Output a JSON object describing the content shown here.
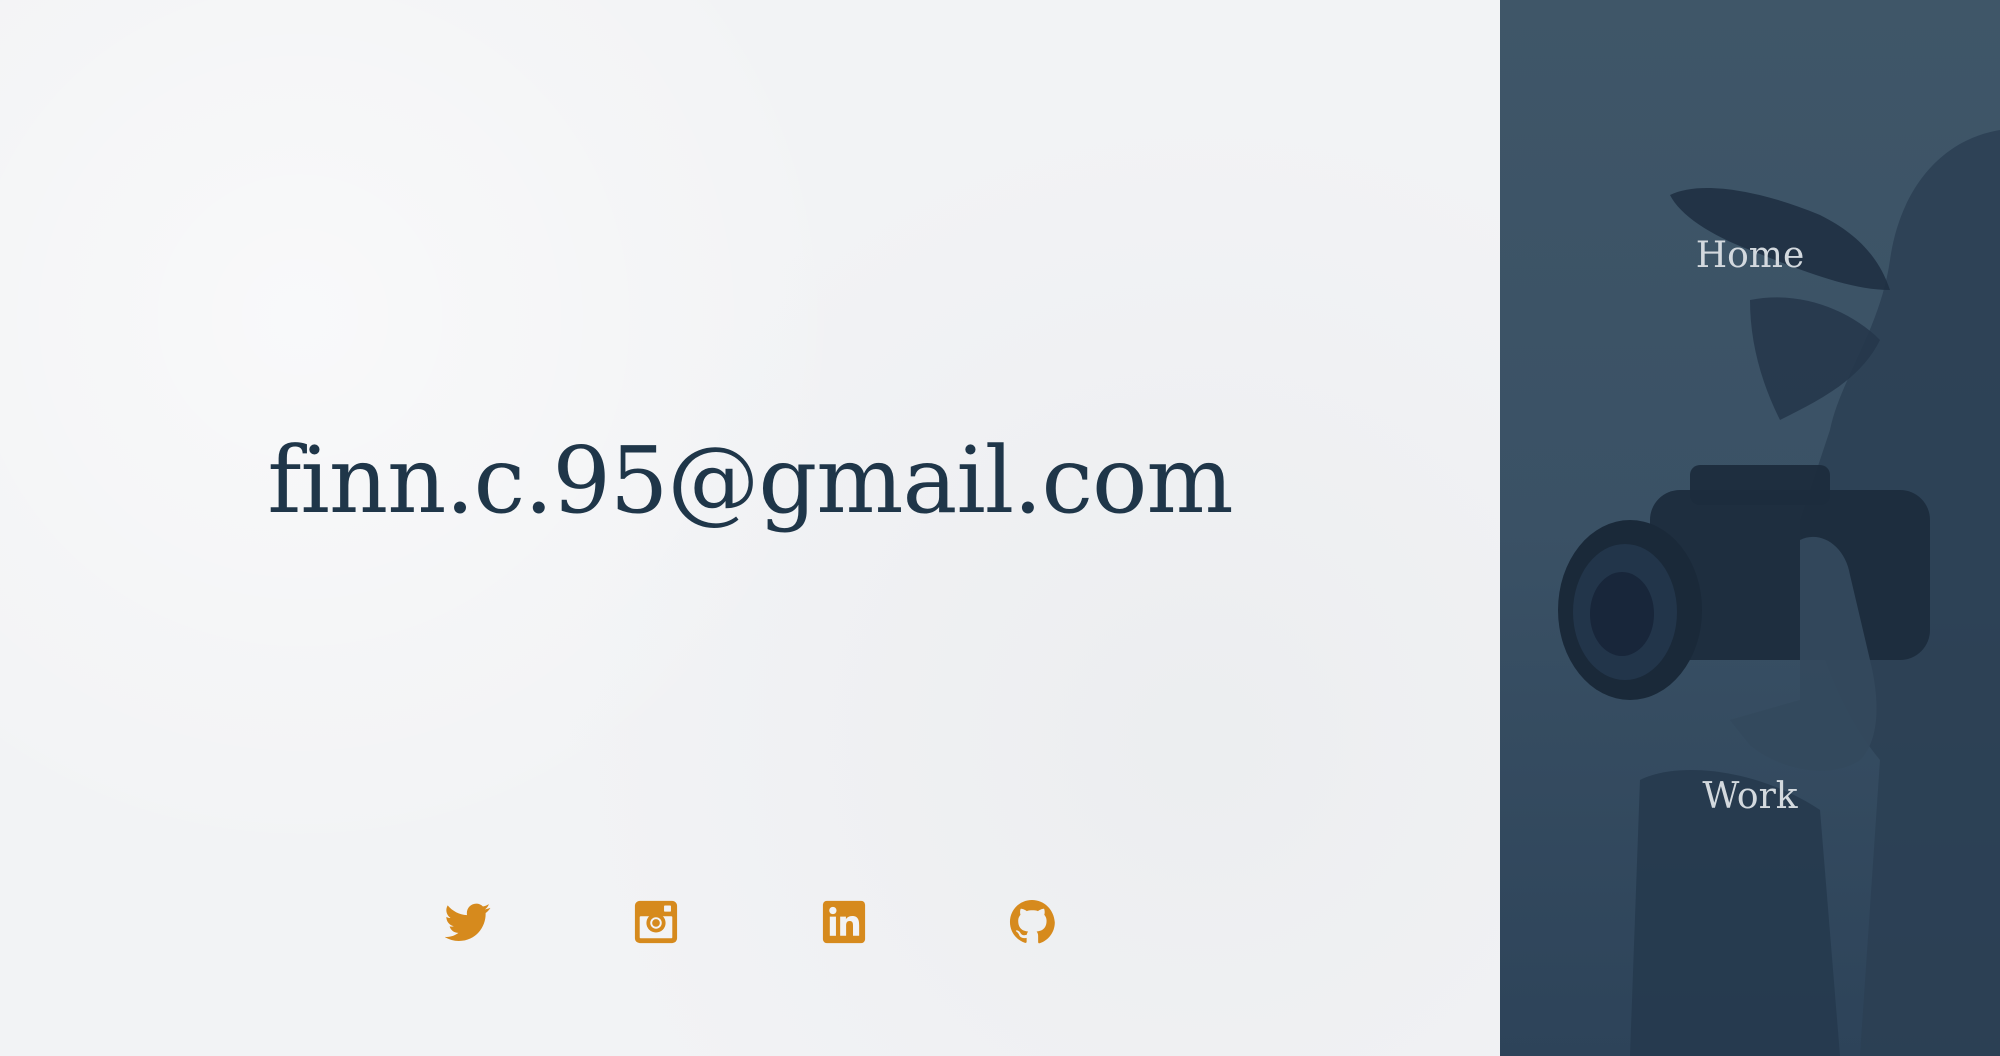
{
  "contact": {
    "email": "finn.c.95@gmail.com"
  },
  "socials": [
    {
      "name": "twitter",
      "icon": "twitter-icon"
    },
    {
      "name": "instagram",
      "icon": "instagram-icon"
    },
    {
      "name": "linkedin",
      "icon": "linkedin-icon"
    },
    {
      "name": "github",
      "icon": "github-icon"
    }
  ],
  "nav": {
    "home_label": "Home",
    "work_label": "Work"
  },
  "colors": {
    "text": "#1f3649",
    "accent": "#d68a1d",
    "sidebar": "#3a5166",
    "background": "#f2f3f5"
  }
}
